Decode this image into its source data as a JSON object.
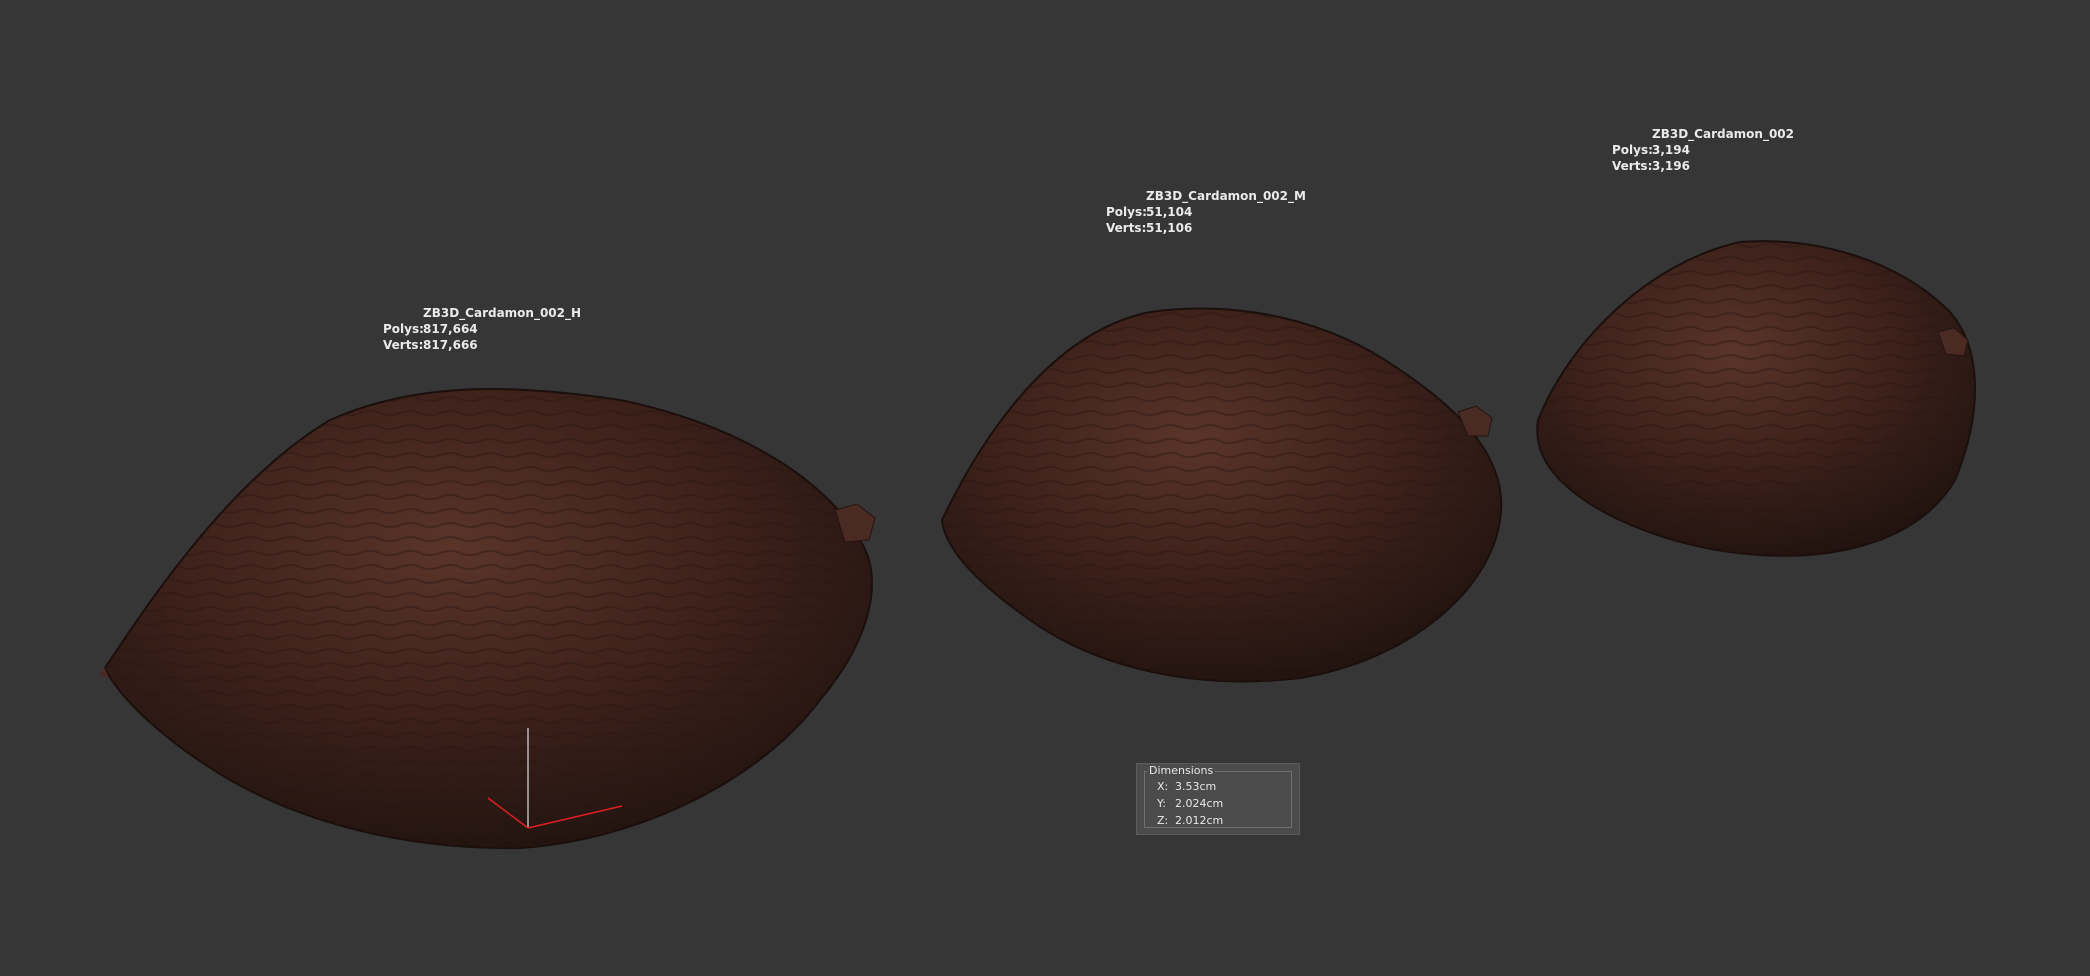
{
  "objects": [
    {
      "name": "ZB3D_Cardamon_002_H",
      "polys_label": "Polys:",
      "polys": "817,664",
      "verts_label": "Verts:",
      "verts": "817,666"
    },
    {
      "name": "ZB3D_Cardamon_002_M",
      "polys_label": "Polys:",
      "polys": "51,104",
      "verts_label": "Verts:",
      "verts": "51,106"
    },
    {
      "name": "ZB3D_Cardamon_002",
      "polys_label": "Polys:",
      "polys": "3,194",
      "verts_label": "Verts:",
      "verts": "3,196"
    }
  ],
  "dimensions": {
    "title": "Dimensions",
    "x_label": "X:",
    "x": "3.53cm",
    "y_label": "Y:",
    "y": "2.024cm",
    "z_label": "Z:",
    "z": "2.012cm"
  },
  "colors": {
    "viewport_bg": "#363636",
    "pod_base": "#3a201b",
    "pod_highlight": "#6a4032",
    "gizmo_x": "#e02020",
    "gizmo_z": "#b8b8b8"
  }
}
